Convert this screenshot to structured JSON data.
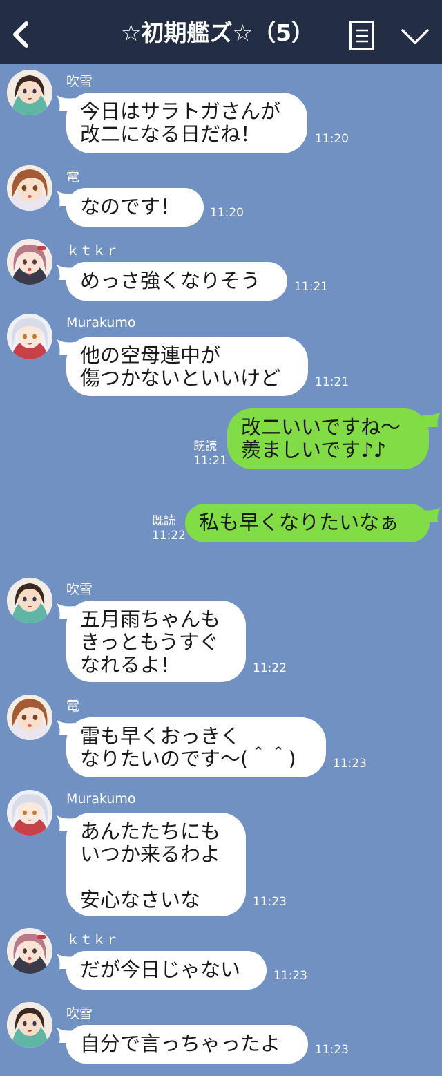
{
  "header": {
    "title": "☆初期艦ズ☆（5）",
    "bg_color": "#232e45"
  },
  "chat": {
    "bg_color": "#7291c3",
    "my_bubble_color": "#82dc46",
    "messages": [
      {
        "sender": "吹雪",
        "text": "今日はサラトガさんが\n改二になる日だね！",
        "time": "11:20"
      },
      {
        "sender": "電",
        "text": "なのです！",
        "time": "11:20"
      },
      {
        "sender": "ｋｔｋｒ",
        "text": "めっさ強くなりそう",
        "time": "11:21"
      },
      {
        "sender": "Murakumo",
        "text": "他の空母連中が\n傷つかないといいけど",
        "time": "11:21"
      },
      {
        "sender": "me",
        "text": "改二いいですね～\n羨ましいです♪♪",
        "read": "既読",
        "time": "11:21"
      },
      {
        "sender": "me",
        "text": "私も早くなりたいなぁ",
        "read": "既読",
        "time": "11:22"
      },
      {
        "sender": "吹雪",
        "text": "五月雨ちゃんも\nきっともうすぐ\nなれるよ！",
        "time": "11:22"
      },
      {
        "sender": "電",
        "text": "雷も早くおっきく\nなりたいのです～(＾＾)",
        "time": "11:23"
      },
      {
        "sender": "Murakumo",
        "text": "あんたたちにも\nいつか来るわよ\n\n安心なさいな",
        "time": "11:23"
      },
      {
        "sender": "ｋｔｋｒ",
        "text": "だが今日じゃない",
        "time": "11:23"
      },
      {
        "sender": "吹雪",
        "text": "自分で言っちゃったよ",
        "time": "11:23"
      }
    ]
  }
}
